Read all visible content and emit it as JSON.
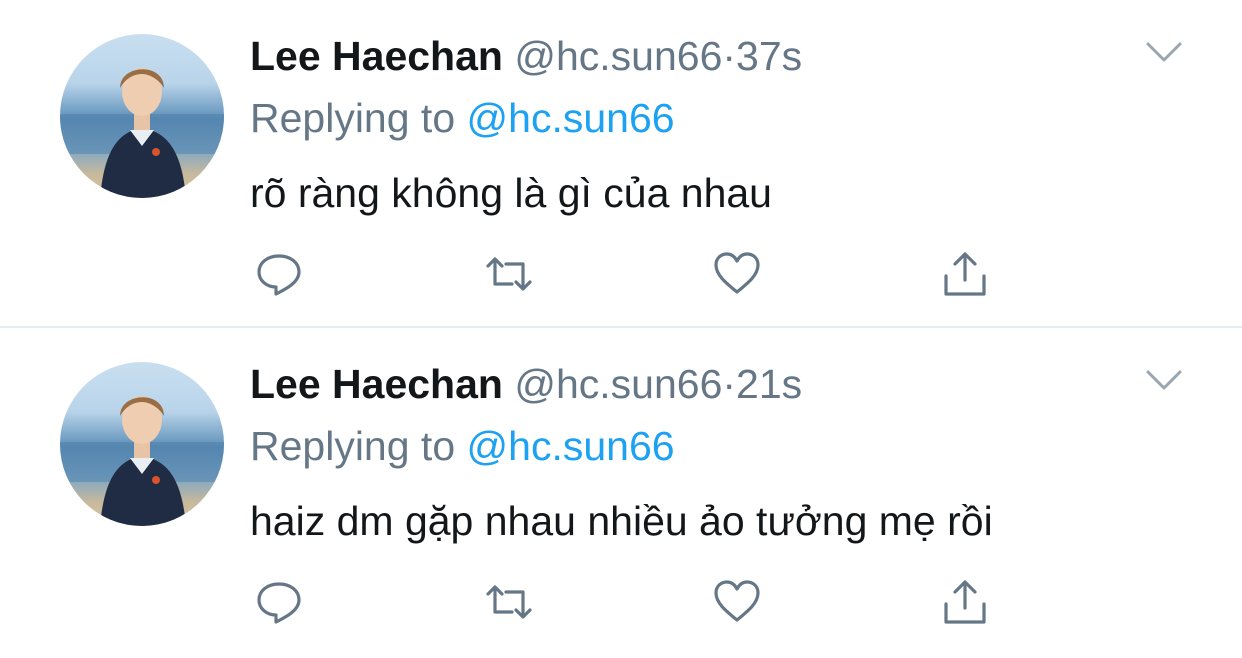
{
  "tweets": [
    {
      "name": "Lee Haechan",
      "handle": "@hc.sun66",
      "separator": "·",
      "time": "37s",
      "replying_prefix": "Replying to",
      "replying_handle": "@hc.sun66",
      "text": "rõ ràng không là gì của nhau"
    },
    {
      "name": "Lee Haechan",
      "handle": "@hc.sun66",
      "separator": "·",
      "time": "21s",
      "replying_prefix": "Replying to",
      "replying_handle": "@hc.sun66",
      "text": "haiz dm gặp nhau nhiều ảo tưởng mẹ rồi"
    }
  ],
  "icons": {
    "reply": "reply-icon",
    "retweet": "retweet-icon",
    "like": "heart-icon",
    "share": "share-icon",
    "menu": "chevron-down-icon"
  },
  "colors": {
    "name": "#14171a",
    "secondary": "#657786",
    "link": "#1da1f2",
    "divider": "#e6ecf0"
  }
}
